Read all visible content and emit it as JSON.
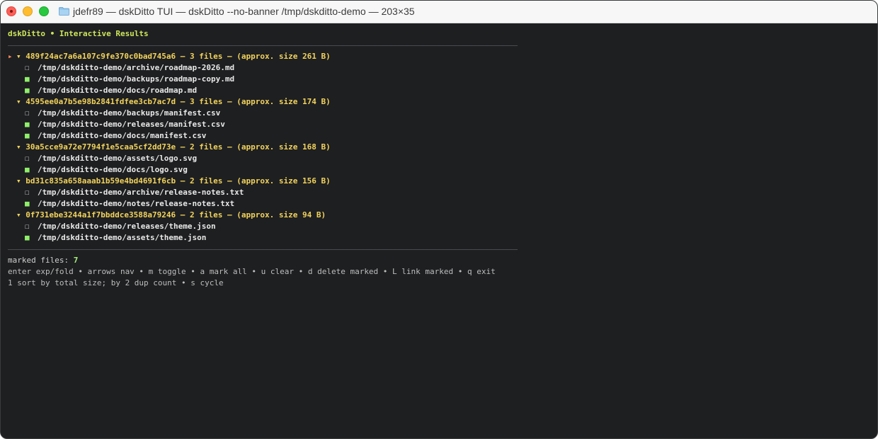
{
  "window": {
    "title": "jdefr89 — dskDitto TUI — dskDitto --no-banner /tmp/dskditto-demo — 203×35",
    "colors": {
      "close": "#ff5f57",
      "minimize": "#febc2e",
      "maximize": "#28c840"
    }
  },
  "app": {
    "title": "dskDitto • Interactive Results"
  },
  "groups": [
    {
      "header": "489f24ac7a6a107c9fe370c0bad745a6 – 3 files – (approx. size 261 B)",
      "cursor": "▸",
      "expander": "▾",
      "files": [
        {
          "mark": "☐",
          "marked": false,
          "path": "/tmp/dskditto-demo/archive/roadmap-2026.md"
        },
        {
          "mark": "■",
          "marked": true,
          "path": "/tmp/dskditto-demo/backups/roadmap-copy.md"
        },
        {
          "mark": "■",
          "marked": true,
          "path": "/tmp/dskditto-demo/docs/roadmap.md"
        }
      ]
    },
    {
      "header": "4595ee0a7b5e98b2841fdfee3cb7ac7d – 3 files – (approx. size 174 B)",
      "cursor": "",
      "expander": "▾",
      "files": [
        {
          "mark": "☐",
          "marked": false,
          "path": "/tmp/dskditto-demo/backups/manifest.csv"
        },
        {
          "mark": "■",
          "marked": true,
          "path": "/tmp/dskditto-demo/releases/manifest.csv"
        },
        {
          "mark": "■",
          "marked": true,
          "path": "/tmp/dskditto-demo/docs/manifest.csv"
        }
      ]
    },
    {
      "header": "30a5cce9a72e7794f1e5caa5cf2dd73e – 2 files – (approx. size 168 B)",
      "cursor": "",
      "expander": "▾",
      "files": [
        {
          "mark": "☐",
          "marked": false,
          "path": "/tmp/dskditto-demo/assets/logo.svg"
        },
        {
          "mark": "■",
          "marked": true,
          "path": "/tmp/dskditto-demo/docs/logo.svg"
        }
      ]
    },
    {
      "header": "bd31c835a658aaab1b59e4bd4691f6cb – 2 files – (approx. size 156 B)",
      "cursor": "",
      "expander": "▾",
      "files": [
        {
          "mark": "☐",
          "marked": false,
          "path": "/tmp/dskditto-demo/archive/release-notes.txt"
        },
        {
          "mark": "■",
          "marked": true,
          "path": "/tmp/dskditto-demo/notes/release-notes.txt"
        }
      ]
    },
    {
      "header": "0f731ebe3244a1f7bbddce3588a79246 – 2 files – (approx. size 94 B)",
      "cursor": "",
      "expander": "▾",
      "files": [
        {
          "mark": "☐",
          "marked": false,
          "path": "/tmp/dskditto-demo/releases/theme.json"
        },
        {
          "mark": "■",
          "marked": true,
          "path": "/tmp/dskditto-demo/assets/theme.json"
        }
      ]
    }
  ],
  "status": {
    "marked_label": "marked files:",
    "marked_count": "7",
    "help_keys": "enter exp/fold • arrows nav • m toggle • a mark all • u clear • d delete marked • L link marked • q exit",
    "help_sort": "1 sort by total size; by 2 dup count • s cycle"
  }
}
